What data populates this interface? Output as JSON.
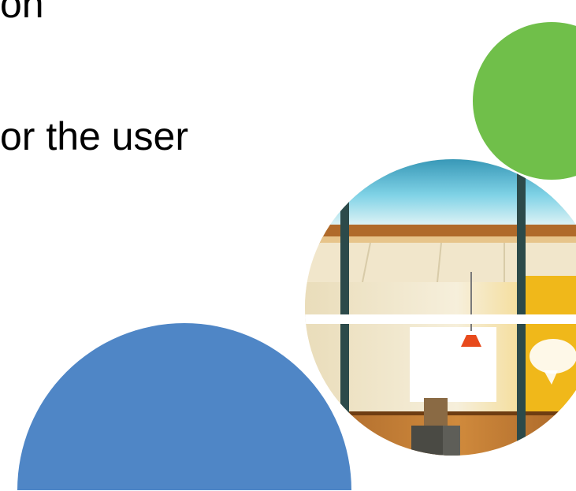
{
  "slide": {
    "text_lines": [
      "on",
      "or the user"
    ]
  },
  "colors": {
    "background": "#ffffff",
    "green_circle": "#70bf4a",
    "blue_semicircle": "#4f86c6",
    "text": "#000000"
  },
  "shapes": [
    {
      "name": "green-circle",
      "color": "green_circle"
    },
    {
      "name": "office-photo-circle",
      "color": "photo"
    },
    {
      "name": "blue-semicircle",
      "color": "blue_semicircle"
    }
  ]
}
